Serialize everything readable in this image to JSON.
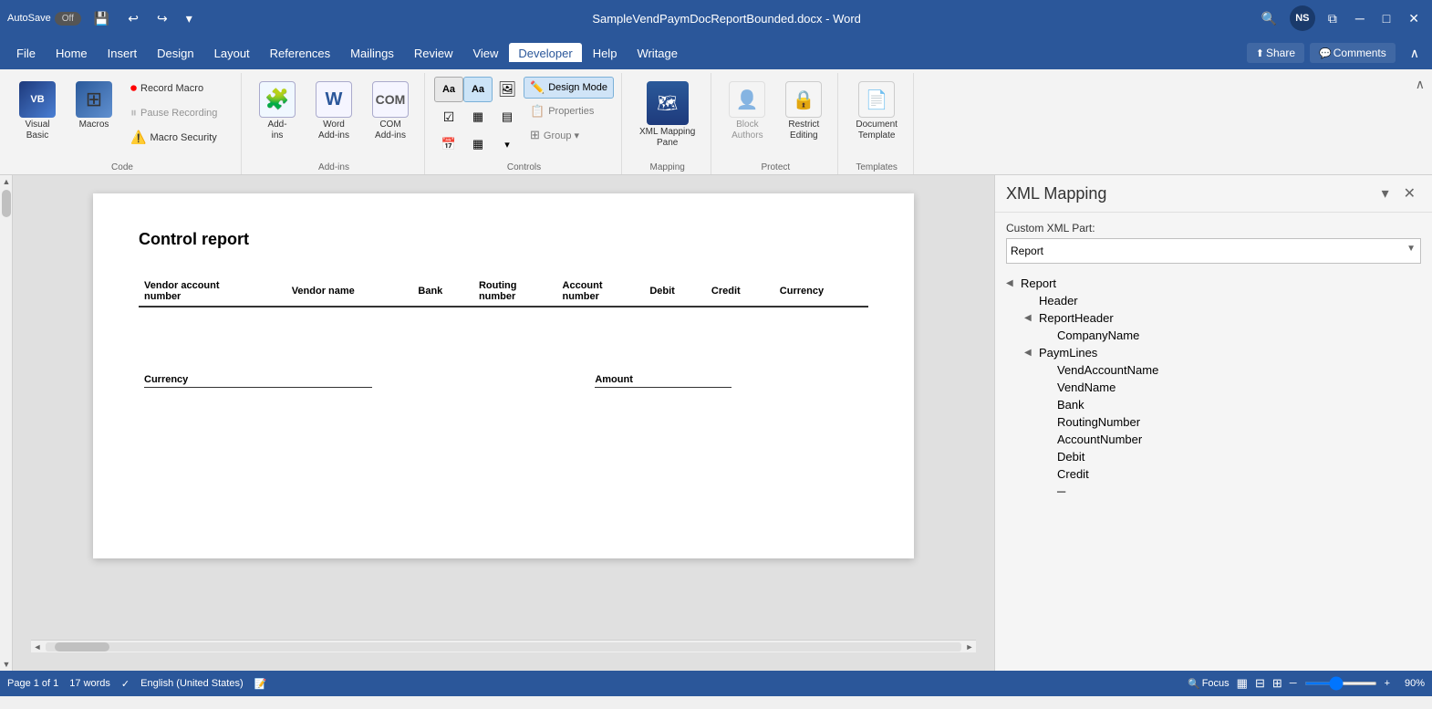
{
  "titleBar": {
    "autosave": "AutoSave",
    "autosave_state": "Off",
    "filename": "SampleVendPaymDocReportBounded.docx - Word",
    "avatar_initials": "NS",
    "window_btns": [
      "─",
      "□",
      "✕"
    ],
    "save_icon": "💾",
    "undo_icon": "↩",
    "redo_icon": "↪"
  },
  "menuBar": {
    "items": [
      "File",
      "Home",
      "Insert",
      "Design",
      "Layout",
      "References",
      "Mailings",
      "Review",
      "View",
      "Developer",
      "Help",
      "Writage"
    ],
    "active_item": "Developer",
    "share_label": "Share",
    "comments_label": "Comments"
  },
  "ribbon": {
    "groups": [
      {
        "label": "Code",
        "items": [
          {
            "type": "large",
            "icon": "⬜",
            "label": "Visual\nBasic"
          },
          {
            "type": "large",
            "icon": "⬜",
            "label": "Macros"
          },
          {
            "type": "col",
            "items": [
              {
                "type": "small",
                "icon": "⏺",
                "label": "Record Macro"
              },
              {
                "type": "small",
                "icon": "⏸",
                "label": "Pause Recording",
                "disabled": true
              },
              {
                "type": "small",
                "icon": "⚠",
                "label": "Macro Security"
              }
            ]
          }
        ]
      },
      {
        "label": "Add-ins",
        "items": [
          {
            "type": "large",
            "icon": "🔲",
            "label": "Add-\nins"
          },
          {
            "type": "large",
            "icon": "⬜",
            "label": "Word\nAdd-ins"
          },
          {
            "type": "large",
            "icon": "⬜",
            "label": "COM\nAdd-ins"
          }
        ]
      },
      {
        "label": "Controls",
        "items": [
          {
            "type": "grid",
            "controls": [
              "Aa",
              "Aa",
              "🖼",
              "📊",
              "☑",
              "▦",
              "▦",
              "⋮",
              "▦",
              "⬜",
              "▦",
              "▦"
            ]
          }
        ]
      },
      {
        "label": "Mapping",
        "items": [
          {
            "type": "large_tall",
            "icon": "🗺",
            "label": "XML Mapping\nPane"
          }
        ]
      },
      {
        "label": "Protect",
        "items": [
          {
            "type": "large",
            "icon": "👤",
            "label": "Block\nAuthors",
            "disabled": true
          },
          {
            "type": "large",
            "icon": "🔒",
            "label": "Restrict\nEditing"
          }
        ]
      },
      {
        "label": "Templates",
        "items": [
          {
            "type": "large",
            "icon": "📄",
            "label": "Document\nTemplate"
          }
        ]
      }
    ],
    "design_mode_label": "Design Mode",
    "properties_label": "Properties",
    "group_label": "Group"
  },
  "document": {
    "title": "Control report",
    "table_headers": [
      "Vendor account\nnumber",
      "Vendor name",
      "Bank",
      "Routing\nnumber",
      "Account\nnumber",
      "Debit",
      "Credit",
      "Currency"
    ],
    "sub_table_headers": [
      "Currency",
      "Amount"
    ]
  },
  "xmlPanel": {
    "title": "XML Mapping",
    "label": "Custom XML Part:",
    "dropdown_value": "Report",
    "tree": [
      {
        "label": "Report",
        "expanded": true,
        "level": 0,
        "children": [
          {
            "label": "Header",
            "level": 1
          },
          {
            "label": "ReportHeader",
            "level": 1,
            "expanded": true,
            "children": [
              {
                "label": "CompanyName",
                "level": 2
              }
            ]
          },
          {
            "label": "PaymLines",
            "level": 1,
            "expanded": true,
            "children": [
              {
                "label": "VendAccountName",
                "level": 2
              },
              {
                "label": "VendName",
                "level": 2
              },
              {
                "label": "Bank",
                "level": 2
              },
              {
                "label": "RoutingNumber",
                "level": 2
              },
              {
                "label": "AccountNumber",
                "level": 2
              },
              {
                "label": "Debit",
                "level": 2
              },
              {
                "label": "Credit",
                "level": 2
              }
            ]
          }
        ]
      }
    ]
  },
  "statusBar": {
    "page": "Page 1 of 1",
    "words": "17 words",
    "language": "English (United States)",
    "focus_label": "Focus",
    "zoom": "90%"
  },
  "controls": {
    "design_mode": "Design Mode",
    "properties": "Properties",
    "group": "Group ▾"
  }
}
